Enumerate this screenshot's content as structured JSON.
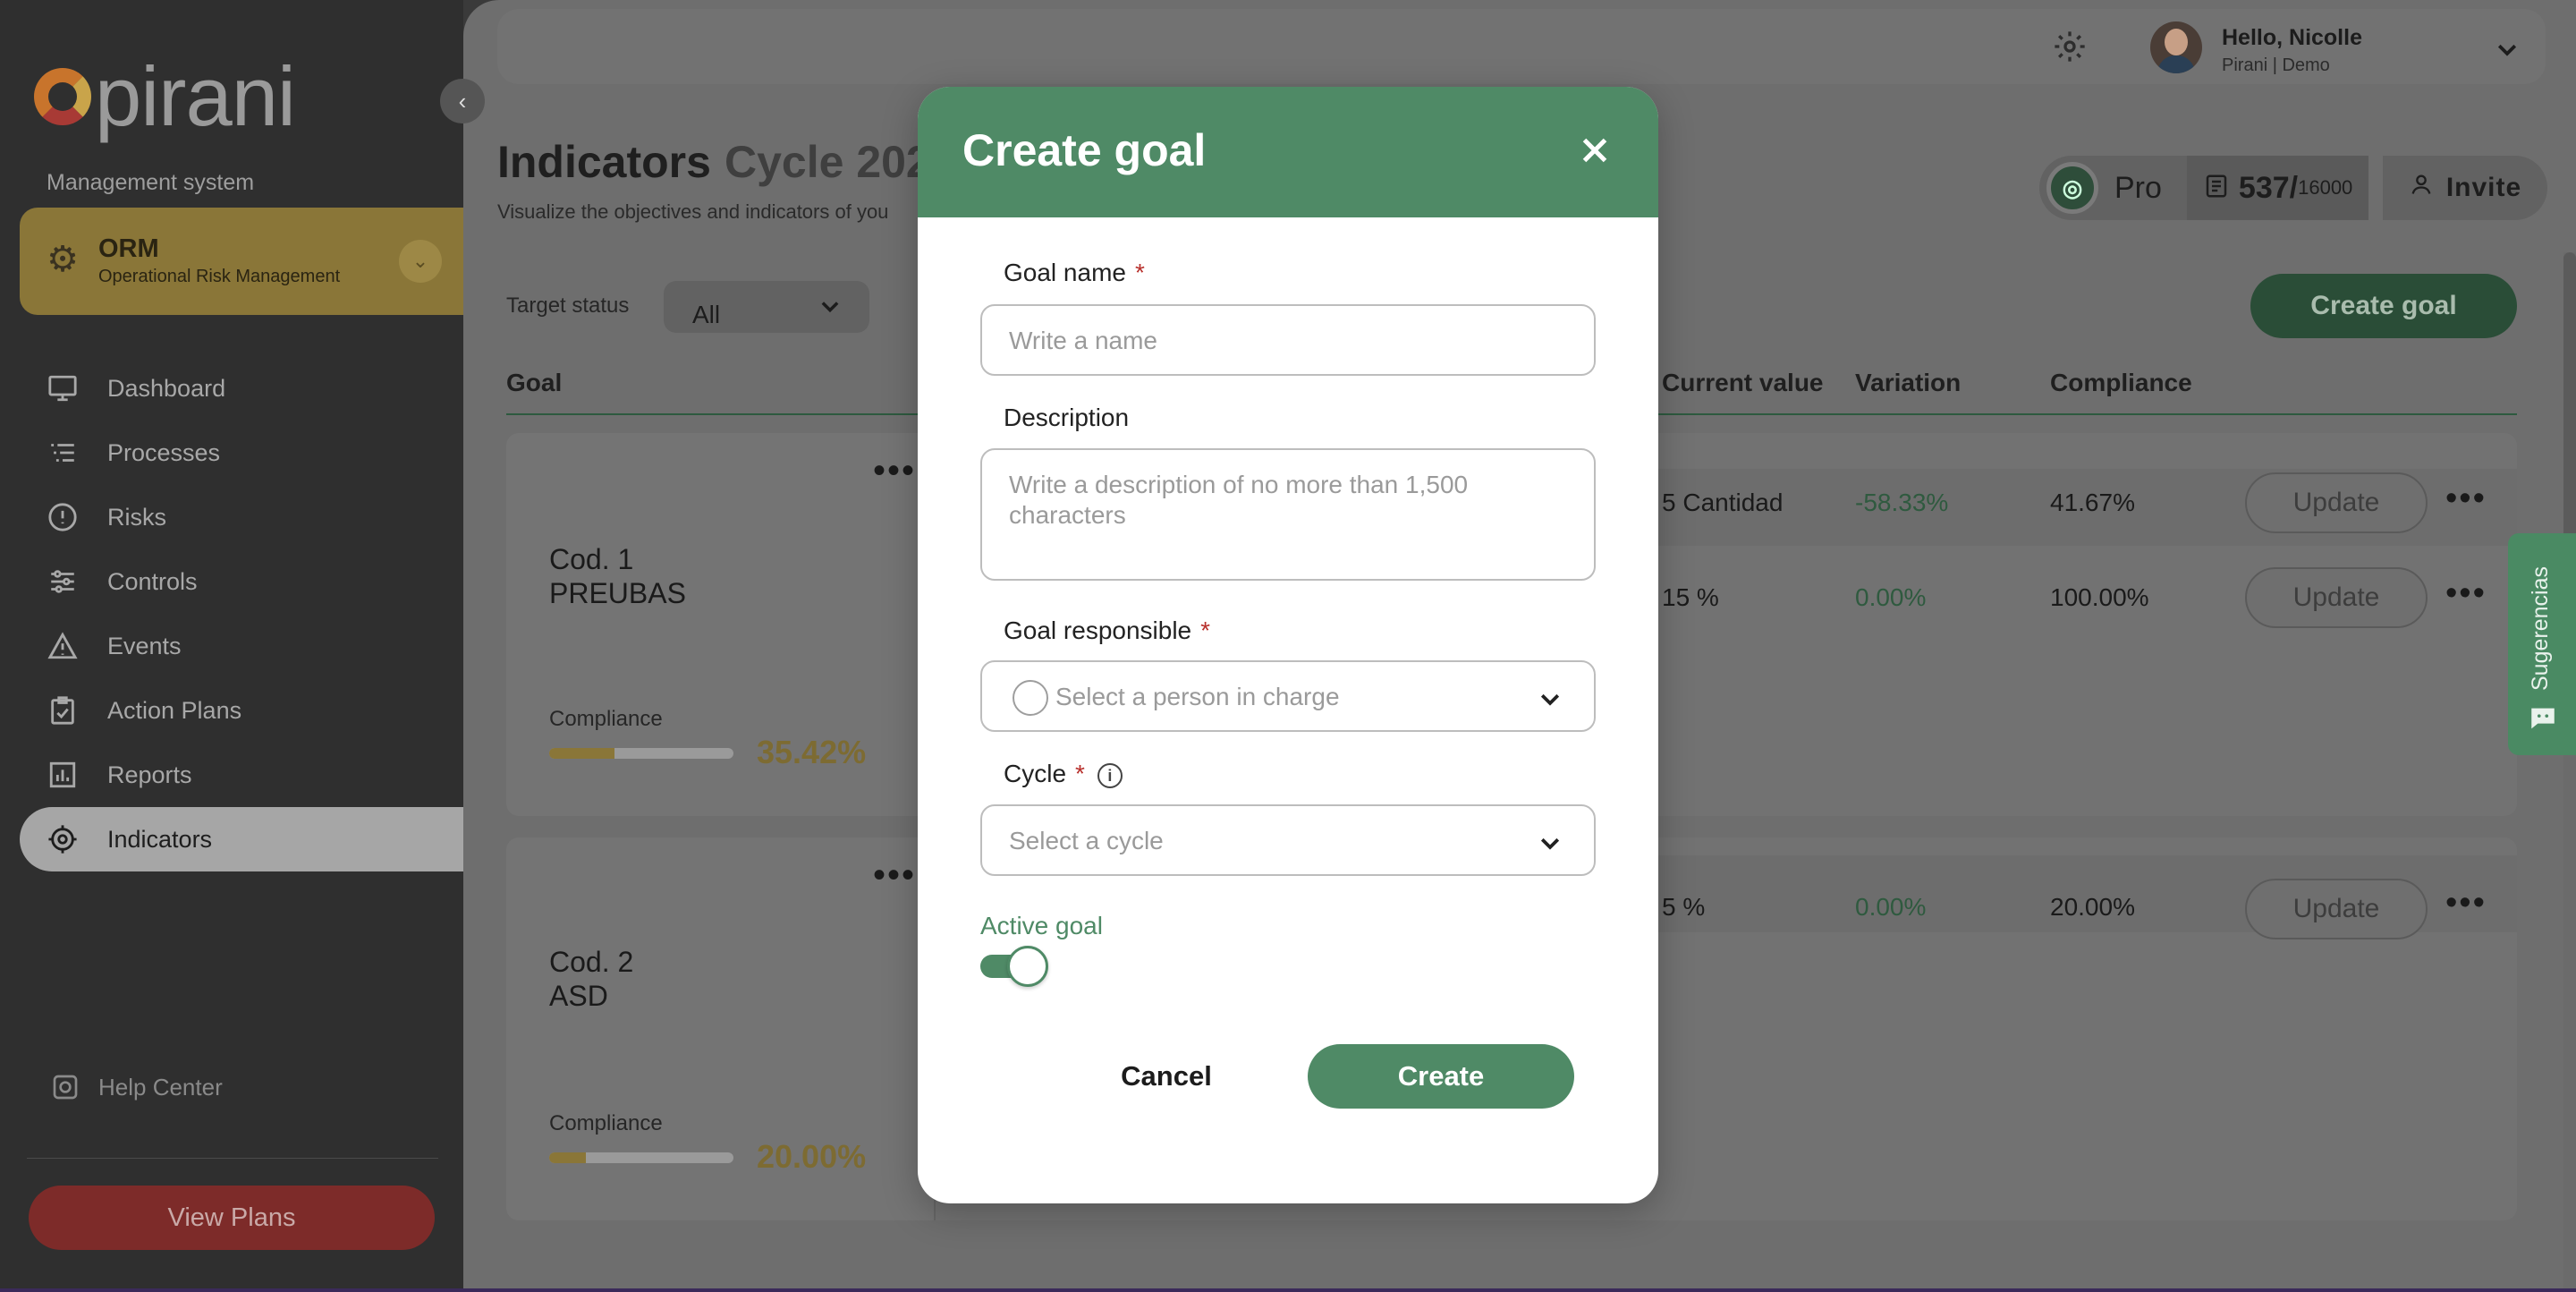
{
  "sidebar": {
    "logo_text": "pirani",
    "management_label": "Management system",
    "module": {
      "name": "ORM",
      "subtitle": "Operational Risk Management"
    },
    "nav": [
      {
        "label": "Dashboard",
        "icon": "monitor-icon"
      },
      {
        "label": "Processes",
        "icon": "list-icon"
      },
      {
        "label": "Risks",
        "icon": "alert-circle-icon"
      },
      {
        "label": "Controls",
        "icon": "sliders-icon"
      },
      {
        "label": "Events",
        "icon": "warning-triangle-icon"
      },
      {
        "label": "Action Plans",
        "icon": "checklist-icon"
      },
      {
        "label": "Reports",
        "icon": "bar-chart-icon"
      },
      {
        "label": "Indicators",
        "icon": "target-icon",
        "active": true
      }
    ],
    "help_center": "Help Center",
    "view_plans": "View Plans"
  },
  "header": {
    "greeting": "Hello, Nicolle",
    "company": "Pirani | Demo"
  },
  "page": {
    "title": "Indicators",
    "cycle": "Cycle 202",
    "subtitle": "Visualize the objectives and indicators of you",
    "plan": "Pro",
    "usage_used": "537/",
    "usage_total": "16000",
    "invite": "Invite",
    "target_status_label": "Target status",
    "target_status_value": "All",
    "create_goal": "Create goal"
  },
  "table": {
    "headers": {
      "goal": "Goal",
      "current_value": "Current value",
      "variation": "Variation",
      "compliance": "Compliance"
    },
    "update_label": "Update",
    "goals": [
      {
        "code": "Cod. 1",
        "name": "PREUBAS",
        "compliance_label": "Compliance",
        "compliance": "35.42%",
        "compliance_fraction": 0.3542,
        "rows": [
          {
            "current_value": "5 Cantidad",
            "variation": "-58.33%",
            "compliance": "41.67%"
          },
          {
            "current_value": "15 %",
            "variation": "0.00%",
            "compliance": "100.00%"
          }
        ]
      },
      {
        "code": "Cod. 2",
        "name": "ASD",
        "compliance_label": "Compliance",
        "compliance": "20.00%",
        "compliance_fraction": 0.2,
        "rows": [
          {
            "current_value": "5 %",
            "variation": "0.00%",
            "compliance": "20.00%"
          }
        ]
      }
    ]
  },
  "suggestions_tab": "Sugerencias",
  "modal": {
    "title": "Create goal",
    "goal_name_label": "Goal name",
    "goal_name_placeholder": "Write a name",
    "description_label": "Description",
    "description_placeholder": "Write a description of no more than 1,500 characters",
    "responsible_label": "Goal responsible",
    "responsible_placeholder": "Select a person in charge",
    "cycle_label": "Cycle",
    "cycle_placeholder": "Select a cycle",
    "required_mark": "*",
    "active_label": "Active goal",
    "active": true,
    "cancel": "Cancel",
    "create": "Create"
  },
  "colors": {
    "brand_green": "#4f8a66",
    "module_gold": "#c9a44a",
    "view_plans_red": "#c9423f"
  }
}
